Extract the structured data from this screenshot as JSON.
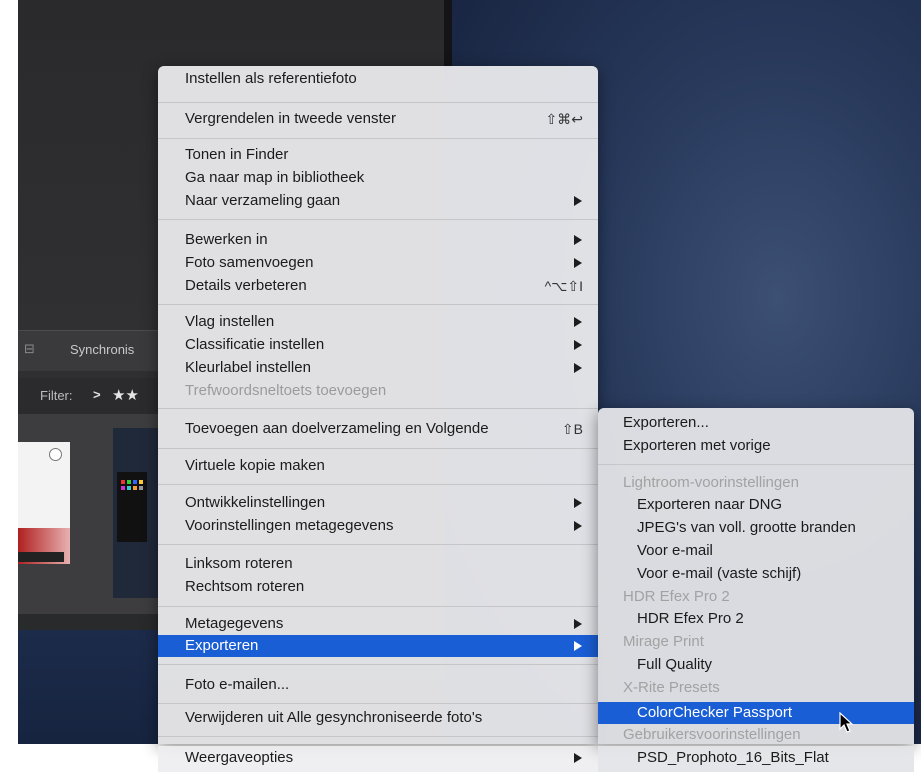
{
  "background": {
    "synchronize_label": "Synchronis",
    "filter_label": "Filter:",
    "filter_symbol": ">",
    "stars": "★★",
    "colors": {
      "dark_panel": "#2a2a2c",
      "desktop_blue": "#27385a",
      "highlight": "#1a5ed6"
    }
  },
  "menu": {
    "items": [
      {
        "label": "Instellen als referentiefoto",
        "shortcut": "",
        "submenu": false,
        "disabled": false,
        "selected": false
      },
      {
        "label": "Vergrendelen in tweede venster",
        "shortcut": "⇧⌘↩",
        "submenu": false,
        "disabled": false,
        "selected": false
      },
      {
        "label": "Tonen in Finder",
        "shortcut": "",
        "submenu": false,
        "disabled": false,
        "selected": false
      },
      {
        "label": "Ga naar map in bibliotheek",
        "shortcut": "",
        "submenu": false,
        "disabled": false,
        "selected": false
      },
      {
        "label": "Naar verzameling gaan",
        "shortcut": "",
        "submenu": true,
        "disabled": false,
        "selected": false
      },
      {
        "label": "Bewerken in",
        "shortcut": "",
        "submenu": true,
        "disabled": false,
        "selected": false
      },
      {
        "label": "Foto samenvoegen",
        "shortcut": "",
        "submenu": true,
        "disabled": false,
        "selected": false
      },
      {
        "label": "Details verbeteren",
        "shortcut": "^⌥⇧I",
        "submenu": false,
        "disabled": false,
        "selected": false
      },
      {
        "label": "Vlag instellen",
        "shortcut": "",
        "submenu": true,
        "disabled": false,
        "selected": false
      },
      {
        "label": "Classificatie instellen",
        "shortcut": "",
        "submenu": true,
        "disabled": false,
        "selected": false
      },
      {
        "label": "Kleurlabel instellen",
        "shortcut": "",
        "submenu": true,
        "disabled": false,
        "selected": false
      },
      {
        "label": "Trefwoordsneltoets toevoegen",
        "shortcut": "",
        "submenu": false,
        "disabled": true,
        "selected": false
      },
      {
        "label": "Toevoegen aan doelverzameling en Volgende",
        "shortcut": "⇧B",
        "submenu": false,
        "disabled": false,
        "selected": false
      },
      {
        "label": "Virtuele kopie maken",
        "shortcut": "",
        "submenu": false,
        "disabled": false,
        "selected": false
      },
      {
        "label": "Ontwikkelinstellingen",
        "shortcut": "",
        "submenu": true,
        "disabled": false,
        "selected": false
      },
      {
        "label": "Voorinstellingen metagegevens",
        "shortcut": "",
        "submenu": true,
        "disabled": false,
        "selected": false
      },
      {
        "label": "Linksom roteren",
        "shortcut": "",
        "submenu": false,
        "disabled": false,
        "selected": false
      },
      {
        "label": "Rechtsom roteren",
        "shortcut": "",
        "submenu": false,
        "disabled": false,
        "selected": false
      },
      {
        "label": "Metagegevens",
        "shortcut": "",
        "submenu": true,
        "disabled": false,
        "selected": false
      },
      {
        "label": "Exporteren",
        "shortcut": "",
        "submenu": true,
        "disabled": false,
        "selected": true
      },
      {
        "label": "Foto e-mailen...",
        "shortcut": "",
        "submenu": false,
        "disabled": false,
        "selected": false
      },
      {
        "label": "Verwijderen uit Alle gesynchroniseerde foto's",
        "shortcut": "",
        "submenu": false,
        "disabled": false,
        "selected": false
      },
      {
        "label": "Weergaveopties",
        "shortcut": "",
        "submenu": true,
        "disabled": false,
        "selected": false
      }
    ]
  },
  "submenu": {
    "items": [
      {
        "label": "Exporteren...",
        "kind": "top",
        "selected": false
      },
      {
        "label": "Exporteren met vorige",
        "kind": "top",
        "selected": false
      },
      {
        "label": "Lightroom-voorinstellingen",
        "kind": "head",
        "selected": false
      },
      {
        "label": "Exporteren naar DNG",
        "kind": "item",
        "selected": false
      },
      {
        "label": "JPEG's van voll. grootte branden",
        "kind": "item",
        "selected": false
      },
      {
        "label": "Voor e-mail",
        "kind": "item",
        "selected": false
      },
      {
        "label": "Voor e-mail (vaste schijf)",
        "kind": "item",
        "selected": false
      },
      {
        "label": "HDR Efex Pro 2",
        "kind": "head",
        "selected": false
      },
      {
        "label": "HDR Efex Pro 2",
        "kind": "item",
        "selected": false
      },
      {
        "label": "Mirage Print",
        "kind": "head",
        "selected": false
      },
      {
        "label": "Full Quality",
        "kind": "item",
        "selected": false
      },
      {
        "label": "X-Rite Presets",
        "kind": "head",
        "selected": false
      },
      {
        "label": "ColorChecker Passport",
        "kind": "item",
        "selected": true
      },
      {
        "label": "Gebruikersvoorinstellingen",
        "kind": "head",
        "selected": false
      },
      {
        "label": "PSD_Prophoto_16_Bits_Flat",
        "kind": "item",
        "selected": false
      }
    ]
  }
}
